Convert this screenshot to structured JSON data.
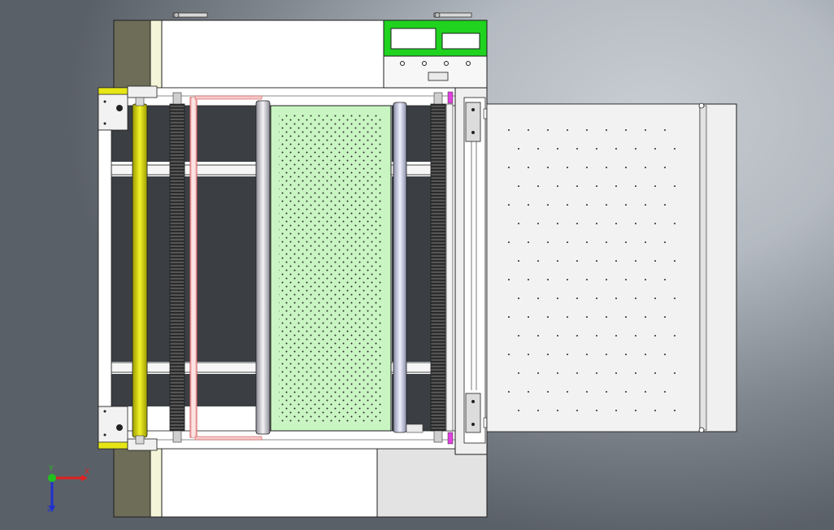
{
  "viewport": {
    "title": "",
    "background": "#9aa1a8"
  },
  "machine": {
    "frame_color": "#ffffff",
    "outline_color": "#1e1e1e",
    "side_strip_color": "#6d6d58",
    "side_inner_color": "#f4f4d8",
    "control_panel_color": "#1fd31f",
    "perforated_plate_color": "#c9f5c2",
    "yellow_roller_color": "#e6e617",
    "pink_roller_color": "#f2a0a0",
    "conveyor_table_color": "#f0f0f0",
    "gantry_color": "#d8d8d8",
    "magenta_marker_color": "#e040e0"
  },
  "triad": {
    "x_label": "X",
    "y_label": "Y",
    "z_label": "Z",
    "x_color": "#e02020",
    "y_color": "#20c020",
    "z_color": "#2030d0"
  }
}
